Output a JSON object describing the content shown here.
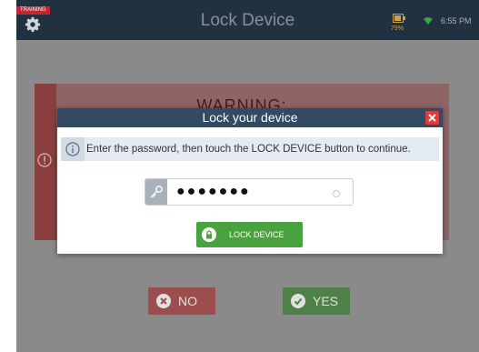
{
  "topbar": {
    "badge": "TRAINING",
    "title": "Lock Device",
    "battery_percent": "79%",
    "time": "6:55 PM",
    "icons": {
      "settings": "gear-icon",
      "battery": "battery-icon",
      "network": "wifi-icon"
    }
  },
  "background": {
    "warning_title": "WARNING:",
    "no_label": "NO",
    "yes_label": "YES"
  },
  "dialog": {
    "title": "Lock your device",
    "info_text": "Enter the password, then touch the LOCK DEVICE button to continue.",
    "password_value": "●●●●●●●",
    "lock_button_label": "LOCK DEVICE"
  },
  "colors": {
    "topbar": "#22313f",
    "dialog_header": "#324a63",
    "close": "#e23a3a",
    "lock_button": "#4aa23e",
    "no_button": "#a23a3a",
    "yes_button": "#3a7e32"
  }
}
